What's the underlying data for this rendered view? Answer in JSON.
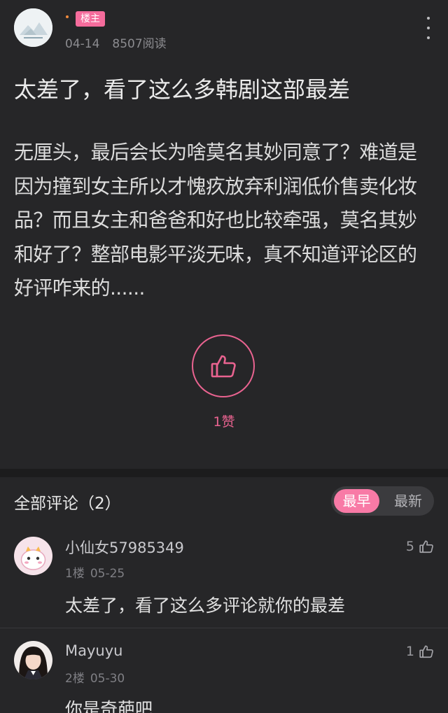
{
  "post": {
    "owner_badge": "楼主",
    "date": "04-14",
    "views": "8507阅读",
    "title": "太差了，看了这么多韩剧这部最差",
    "body": "无厘头，最后会长为啥莫名其妙同意了？难道是因为撞到女主所以才愧疚放弃利润低价售卖化妆品？而且女主和爸爸和好也比较牵强，莫名其妙和好了？整部电影平淡无味，真不知道评论区的好评咋来的......",
    "like_label": "1赞",
    "accent_color": "#e96390"
  },
  "comments_section": {
    "header": "全部评论（2）",
    "sort_options": [
      "最早",
      "最新"
    ],
    "selected_sort": "最早"
  },
  "comments": [
    {
      "username": "小仙女57985349",
      "floor": "1楼",
      "date": "05-25",
      "text": "太差了，看了这么多评论就你的最差",
      "likes": "5"
    },
    {
      "username": "Mayuyu",
      "floor": "2楼",
      "date": "05-30",
      "text": "你是奇葩吧",
      "likes": "1"
    }
  ],
  "icons": {
    "more": "more-vertical-icon",
    "like": "thumbs-up-icon"
  }
}
